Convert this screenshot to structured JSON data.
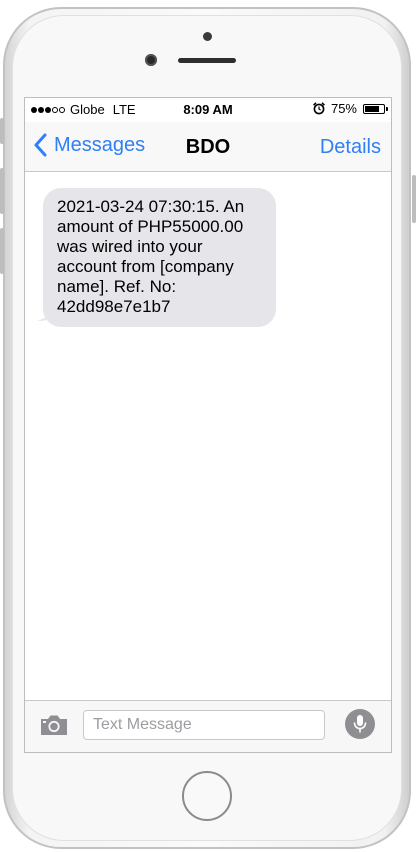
{
  "status_bar": {
    "signal_bars_filled": 3,
    "signal_bars_total": 5,
    "carrier": "Globe",
    "network": "LTE",
    "time": "8:09 AM",
    "alarm_icon": "alarm-clock-icon",
    "battery_percent": "75%",
    "battery_level": 0.75
  },
  "nav": {
    "back_label": "Messages",
    "back_icon": "chevron-left-icon",
    "title": "BDO",
    "details_label": "Details",
    "accent_color": "#2f7ff5"
  },
  "conversation": {
    "messages": [
      {
        "direction": "incoming",
        "text": "2021-03-24 07:30:15. An amount of PHP55000.00 was wired into your account from [company name]. Ref. No: 42dd98e7e1b7",
        "bubble_color": "#e5e5ea"
      }
    ]
  },
  "input_bar": {
    "camera_icon": "camera-icon",
    "placeholder": "Text Message",
    "value": "",
    "mic_icon": "microphone-icon"
  }
}
